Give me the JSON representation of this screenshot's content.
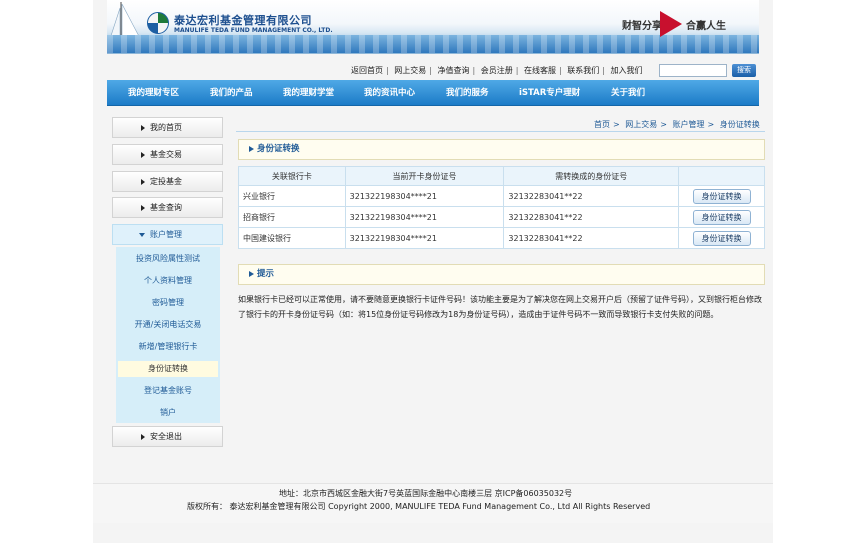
{
  "header": {
    "company_cn": "泰达宏利基金管理有限公司",
    "company_en": "MANULIFE TEDA FUND MANAGEMENT CO., LTD.",
    "slogan_left": "财智分享",
    "slogan_right": "合赢人生",
    "brand_red": "#c8102e",
    "brand_blue": "#1d4f8f"
  },
  "top_links": [
    "返回首页",
    "网上交易",
    "净值查询",
    "会员注册",
    "在线客服",
    "联系我们",
    "加入我们"
  ],
  "search": {
    "button_label": "搜索",
    "value": ""
  },
  "nav": [
    "我的理财专区",
    "我们的产品",
    "我的理财学堂",
    "我的资讯中心",
    "我们的服务",
    "iSTAR专户理财",
    "关于我们"
  ],
  "sidebar": {
    "items": [
      {
        "label": "我的首页"
      },
      {
        "label": "基金交易"
      },
      {
        "label": "定投基金"
      },
      {
        "label": "基金查询"
      },
      {
        "label": "账户管理"
      }
    ],
    "sub_items": [
      {
        "label": "投资风险属性测试"
      },
      {
        "label": "个人资料管理"
      },
      {
        "label": "密码管理"
      },
      {
        "label": "开通/关闭电话交易"
      },
      {
        "label": "新增/管理银行卡"
      },
      {
        "label": "身份证转换"
      },
      {
        "label": "登记基金账号"
      },
      {
        "label": "销户"
      }
    ],
    "logout": "安全退出"
  },
  "breadcrumb": [
    "首页",
    "网上交易",
    "账户管理",
    "身份证转换"
  ],
  "main": {
    "section_title": "身份证转换",
    "table": {
      "headers": [
        "关联银行卡",
        "当前开卡身份证号",
        "需转换成的身份证号",
        ""
      ],
      "rows": [
        {
          "bank": "兴业银行",
          "current_id": "321322198304****21",
          "new_id": "32132283041**22",
          "action": "身份证转换"
        },
        {
          "bank": "招商银行",
          "current_id": "321322198304****21",
          "new_id": "32132283041**22",
          "action": "身份证转换"
        },
        {
          "bank": "中国建设银行",
          "current_id": "321322198304****21",
          "new_id": "32132283041**22",
          "action": "身份证转换"
        }
      ]
    },
    "tip_title": "提示",
    "tip_text": "如果银行卡已经可以正常使用，请不要随意更换银行卡证件号码！该功能主要是为了解决您在网上交易开户后（预留了证件号码），又到银行柜台修改了银行卡的开卡身份证号码（如：将15位身份证号码修改为18为身份证号码），造成由于证件号码不一致而导致银行卡支付失败的问题。"
  },
  "footer": {
    "address": "地址：北京市西城区金融大街7号英蓝国际金融中心南楼三层 京ICP备06035032号",
    "copyright": "版权所有： 泰达宏利基金管理有限公司 Copyright 2000, MANULIFE TEDA Fund Management Co., Ltd All Rights Reserved"
  }
}
